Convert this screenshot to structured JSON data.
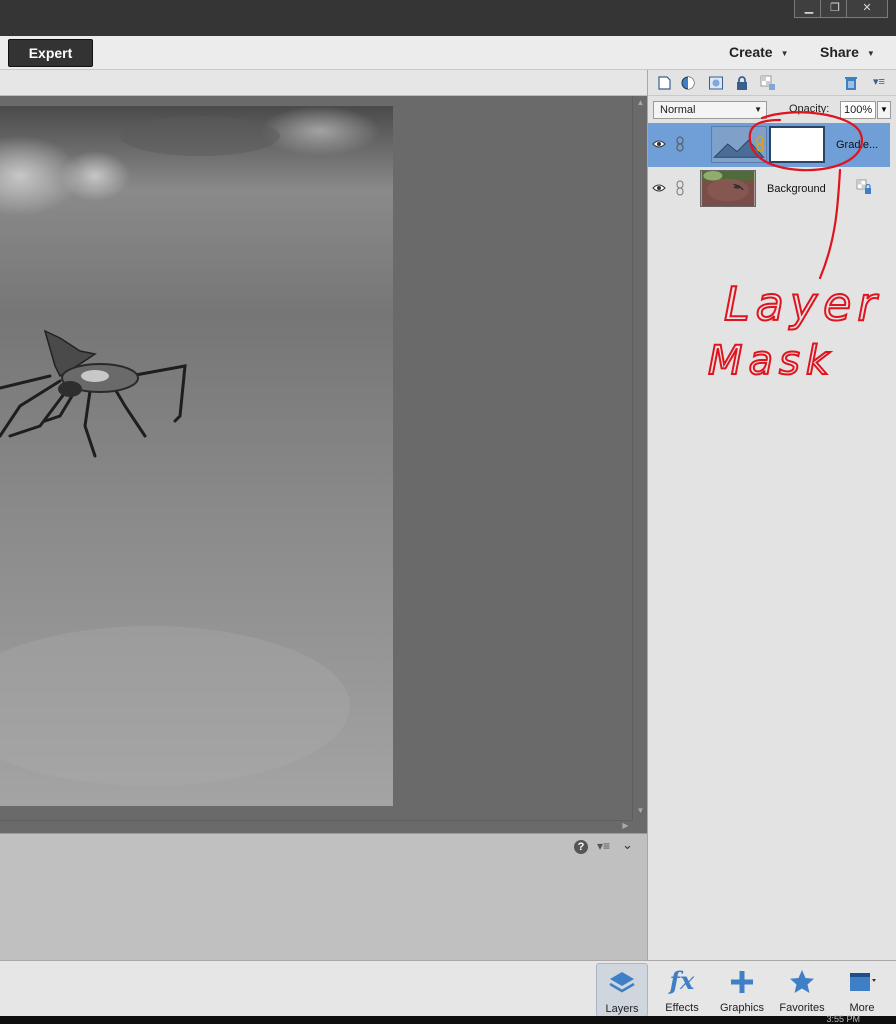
{
  "window": {
    "minimize_glyph": "▁",
    "restore_glyph": "❐",
    "close_glyph": "✕"
  },
  "modebar": {
    "expert_label": "Expert",
    "create_label": "Create",
    "share_label": "Share"
  },
  "tool_options": {
    "help_glyph": "?",
    "menu_glyph": "▾≡",
    "collapse_glyph": "⌄"
  },
  "layers_panel": {
    "blend_mode": "Normal",
    "opacity_label": "Opacity:",
    "opacity_value": "100%",
    "layers": [
      {
        "name": "Gradie...",
        "selected": true,
        "has_mask": true
      },
      {
        "name": "Background",
        "selected": false,
        "locked": true
      }
    ]
  },
  "annotation": {
    "line1": "Layer",
    "line2": "Mask",
    "color": "#e0141e"
  },
  "panel_bin": {
    "items": [
      {
        "label": "Layers",
        "icon": "layers-icon"
      },
      {
        "label": "Effects",
        "icon": "fx-icon"
      },
      {
        "label": "Graphics",
        "icon": "plus-icon"
      },
      {
        "label": "Favorites",
        "icon": "star-icon"
      },
      {
        "label": "More",
        "icon": "more-panels-icon"
      }
    ]
  },
  "taskbar": {
    "clock": "3:55 PM"
  },
  "colors": {
    "selected_layer": "#6f9fd6",
    "accent_blue": "#3f7fc6"
  }
}
